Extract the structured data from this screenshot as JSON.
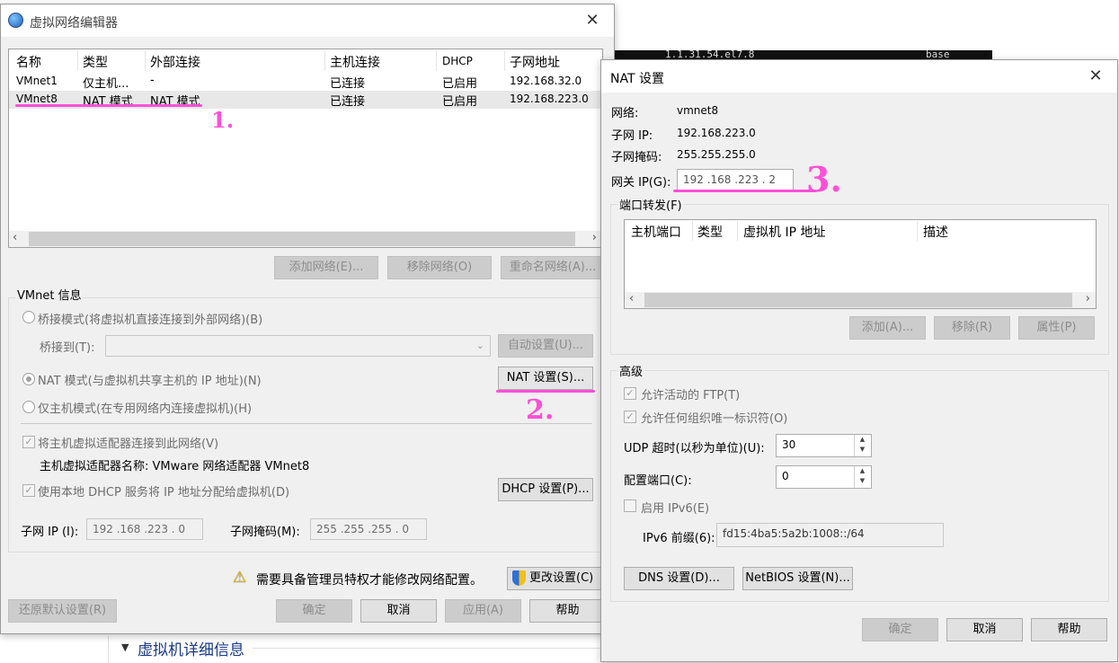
{
  "background": {
    "terminal_text": "1.1.31.54.el7.8",
    "terminal_text_right": "base",
    "details_label": "虚拟机详细信息"
  },
  "vne": {
    "title": "虚拟网络编辑器",
    "columns": [
      "名称",
      "类型",
      "外部连接",
      "主机连接",
      "DHCP",
      "子网地址"
    ],
    "rows": [
      {
        "name": "VMnet1",
        "type": "仅主机...",
        "external": "-",
        "host": "已连接",
        "dhcp": "已启用",
        "subnet": "192.168.32.0"
      },
      {
        "name": "VMnet8",
        "type": "NAT 模式",
        "external": "NAT 模式",
        "host": "已连接",
        "dhcp": "已启用",
        "subnet": "192.168.223.0"
      }
    ],
    "add_network": "添加网络(E)...",
    "remove_network": "移除网络(O)",
    "rename_network": "重命名网络(A)...",
    "vmnet_info": "VMnet 信息",
    "bridge_mode": "桥接模式(将虚拟机直接连接到外部网络)(B)",
    "bridge_to": "桥接到(T):",
    "auto_settings": "自动设置(U)...",
    "nat_mode": "NAT 模式(与虚拟机共享主机的 IP 地址)(N)",
    "nat_settings": "NAT 设置(S)...",
    "host_only": "仅主机模式(在专用网络内连接虚拟机)(H)",
    "connect_adapter": "将主机虚拟适配器连接到此网络(V)",
    "adapter_name": "主机虚拟适配器名称: VMware 网络适配器 VMnet8",
    "use_dhcp": "使用本地 DHCP 服务将 IP 地址分配给虚拟机(D)",
    "dhcp_settings": "DHCP 设置(P)...",
    "subnet_ip_label": "子网 IP (I):",
    "subnet_ip": "192 .168 .223 . 0",
    "subnet_mask_label": "子网掩码(M):",
    "subnet_mask": "255 .255 .255 . 0",
    "admin_warning": "需要具备管理员特权才能修改网络配置。",
    "change_settings": "更改设置(C)",
    "restore_defaults": "还原默认设置(R)",
    "ok": "确定",
    "cancel": "取消",
    "apply": "应用(A)",
    "help": "帮助",
    "annot1": "1.",
    "annot2": "2."
  },
  "nat": {
    "title": "NAT 设置",
    "network_label": "网络:",
    "network": "vmnet8",
    "subnet_ip_label": "子网 IP:",
    "subnet_ip": "192.168.223.0",
    "subnet_mask_label": "子网掩码:",
    "subnet_mask": "255.255.255.0",
    "gateway_label": "网关 IP(G):",
    "gateway": "192 .168 .223 . 2",
    "port_forward": "端口转发(F)",
    "pf_columns": [
      "主机端口",
      "类型",
      "虚拟机 IP 地址",
      "描述"
    ],
    "add": "添加(A)...",
    "remove": "移除(R)",
    "properties": "属性(P)",
    "advanced": "高级",
    "allow_ftp": "允许活动的 FTP(T)",
    "allow_oui": "允许任何组织唯一标识符(O)",
    "udp_timeout_label": "UDP 超时(以秒为单位)(U):",
    "udp_timeout": "30",
    "config_port_label": "配置端口(C):",
    "config_port": "0",
    "enable_ipv6": "启用 IPv6(E)",
    "ipv6_prefix_label": "IPv6 前缀(6):",
    "ipv6_prefix": "fd15:4ba5:5a2b:1008::/64",
    "dns_settings": "DNS 设置(D)...",
    "netbios_settings": "NetBIOS 设置(N)...",
    "ok": "确定",
    "cancel": "取消",
    "help": "帮助",
    "annot3": "3."
  },
  "colors": {
    "annotation": "#ff4fd8",
    "accent": "#0078d7"
  }
}
